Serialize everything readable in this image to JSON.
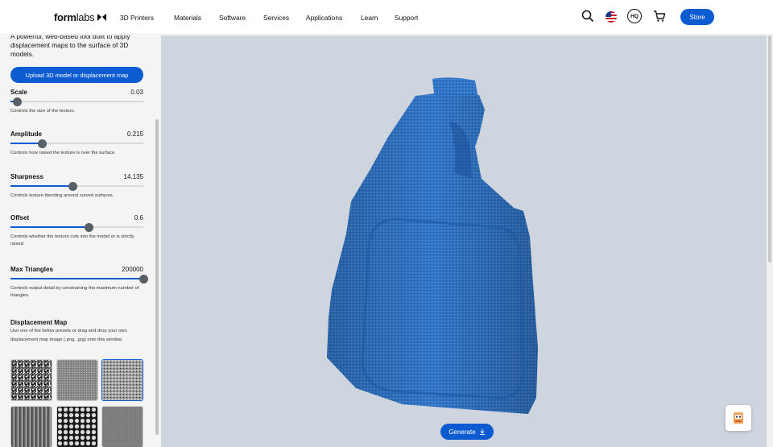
{
  "header": {
    "logo_bold": "form",
    "logo_thin": "labs",
    "nav": [
      "3D Printers",
      "Materials",
      "Software",
      "Services",
      "Applications",
      "Learn",
      "Support"
    ],
    "hq_label": "HQ",
    "store_label": "Store",
    "icons": [
      "search-icon",
      "us-flag-icon",
      "hq-icon",
      "cart-icon"
    ]
  },
  "sidebar": {
    "intro": "A powerful, web-based tool built to apply displacement maps to the surface of 3D models.",
    "upload_label": "Upload 3D model or displacement map",
    "params": [
      {
        "label": "Scale",
        "value": "0.03",
        "fraction": 0.05,
        "desc": "Controls the size of the texture."
      },
      {
        "label": "Amplitude",
        "value": "0.215",
        "fraction": 0.24,
        "desc": "Controls how raised the texture is over the surface."
      },
      {
        "label": "Sharpness",
        "value": "14.135",
        "fraction": 0.47,
        "desc": "Controls texture blending around curved surfaces."
      },
      {
        "label": "Offset",
        "value": "0.6",
        "fraction": 0.59,
        "desc": "Controls whether the texture cuts into the model or is strictly raised."
      },
      {
        "label": "Max Triangles",
        "value": "200000",
        "fraction": 1.0,
        "desc": "Controls output detail by constraining the maximum number of triangles."
      }
    ],
    "displacement_map": {
      "title": "Displacement Map",
      "desc": "Use one of the below presets or drag and drop your own displacement map image (.png, .jpg) onto this window.",
      "selected_index": 2
    }
  },
  "viewport": {
    "generate_label": "Generate",
    "model_color": "#2f74c7",
    "background_color": "#cfd5de"
  },
  "colors": {
    "accent": "#0d5bd1"
  }
}
